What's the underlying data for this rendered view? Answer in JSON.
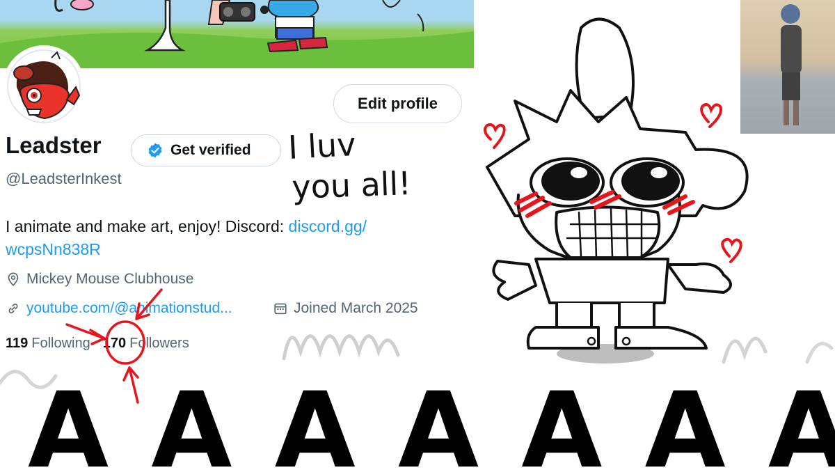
{
  "profile": {
    "display_name": "Leadster",
    "verify_label": "Get verified",
    "handle": "@LeadsterInkest",
    "edit_label": "Edit profile",
    "bio_text": "I animate and make art, enjoy! Discord: ",
    "bio_link_1": "discord.gg/",
    "bio_link_2": "wcpsNn838R",
    "location": "Mickey Mouse Clubhouse",
    "website": "youtube.com/@animationstud...",
    "joined": "Joined March 2025"
  },
  "stats": {
    "following_count": "119",
    "following_label": "Following",
    "followers_count": "170",
    "followers_label": "Followers"
  },
  "handwriting": {
    "line1": "I luv",
    "line2": "you all!",
    "scream": "A A A A A A A"
  },
  "icons": {
    "verify": "verified-badge-icon",
    "location": "location-pin-icon",
    "link": "link-icon",
    "calendar": "calendar-icon"
  },
  "colors": {
    "accent": "#1d9bf0",
    "text": "#0f1419",
    "muted": "#536471",
    "annotation": "#e8141c"
  }
}
